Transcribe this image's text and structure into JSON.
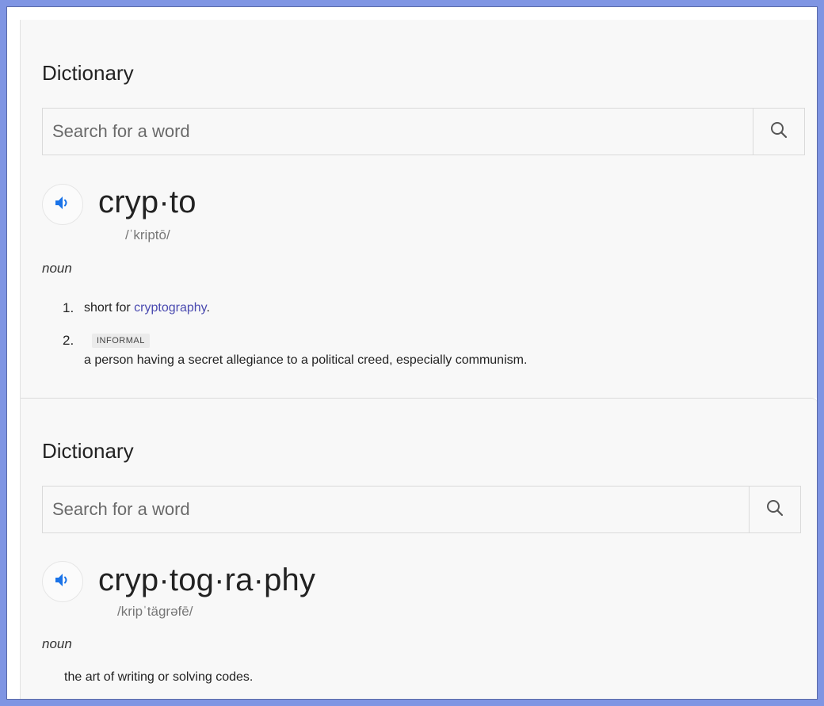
{
  "entries": [
    {
      "section_title": "Dictionary",
      "search": {
        "placeholder": "Search for a word"
      },
      "word": "cryp·to",
      "phonetic": "/ˈkriptō/",
      "part_of_speech": "noun",
      "definitions": [
        {
          "number": "1.",
          "prefix": "short for ",
          "link": "cryptography",
          "suffix": "."
        },
        {
          "number": "2.",
          "label": "INFORMAL",
          "text": "a person having a secret allegiance to a political creed, especially communism."
        }
      ]
    },
    {
      "section_title": "Dictionary",
      "search": {
        "placeholder": "Search for a word"
      },
      "word": "cryp·tog·ra·phy",
      "phonetic": "/kripˈtägrəfē/",
      "part_of_speech": "noun",
      "definitions": [
        {
          "text": "the art of writing or solving codes."
        }
      ]
    }
  ],
  "icons": {
    "search": "search-icon",
    "speaker": "speaker-icon"
  },
  "colors": {
    "accent": "#1a73e8",
    "link": "#4a4ab0",
    "border": "#7f95e3"
  }
}
